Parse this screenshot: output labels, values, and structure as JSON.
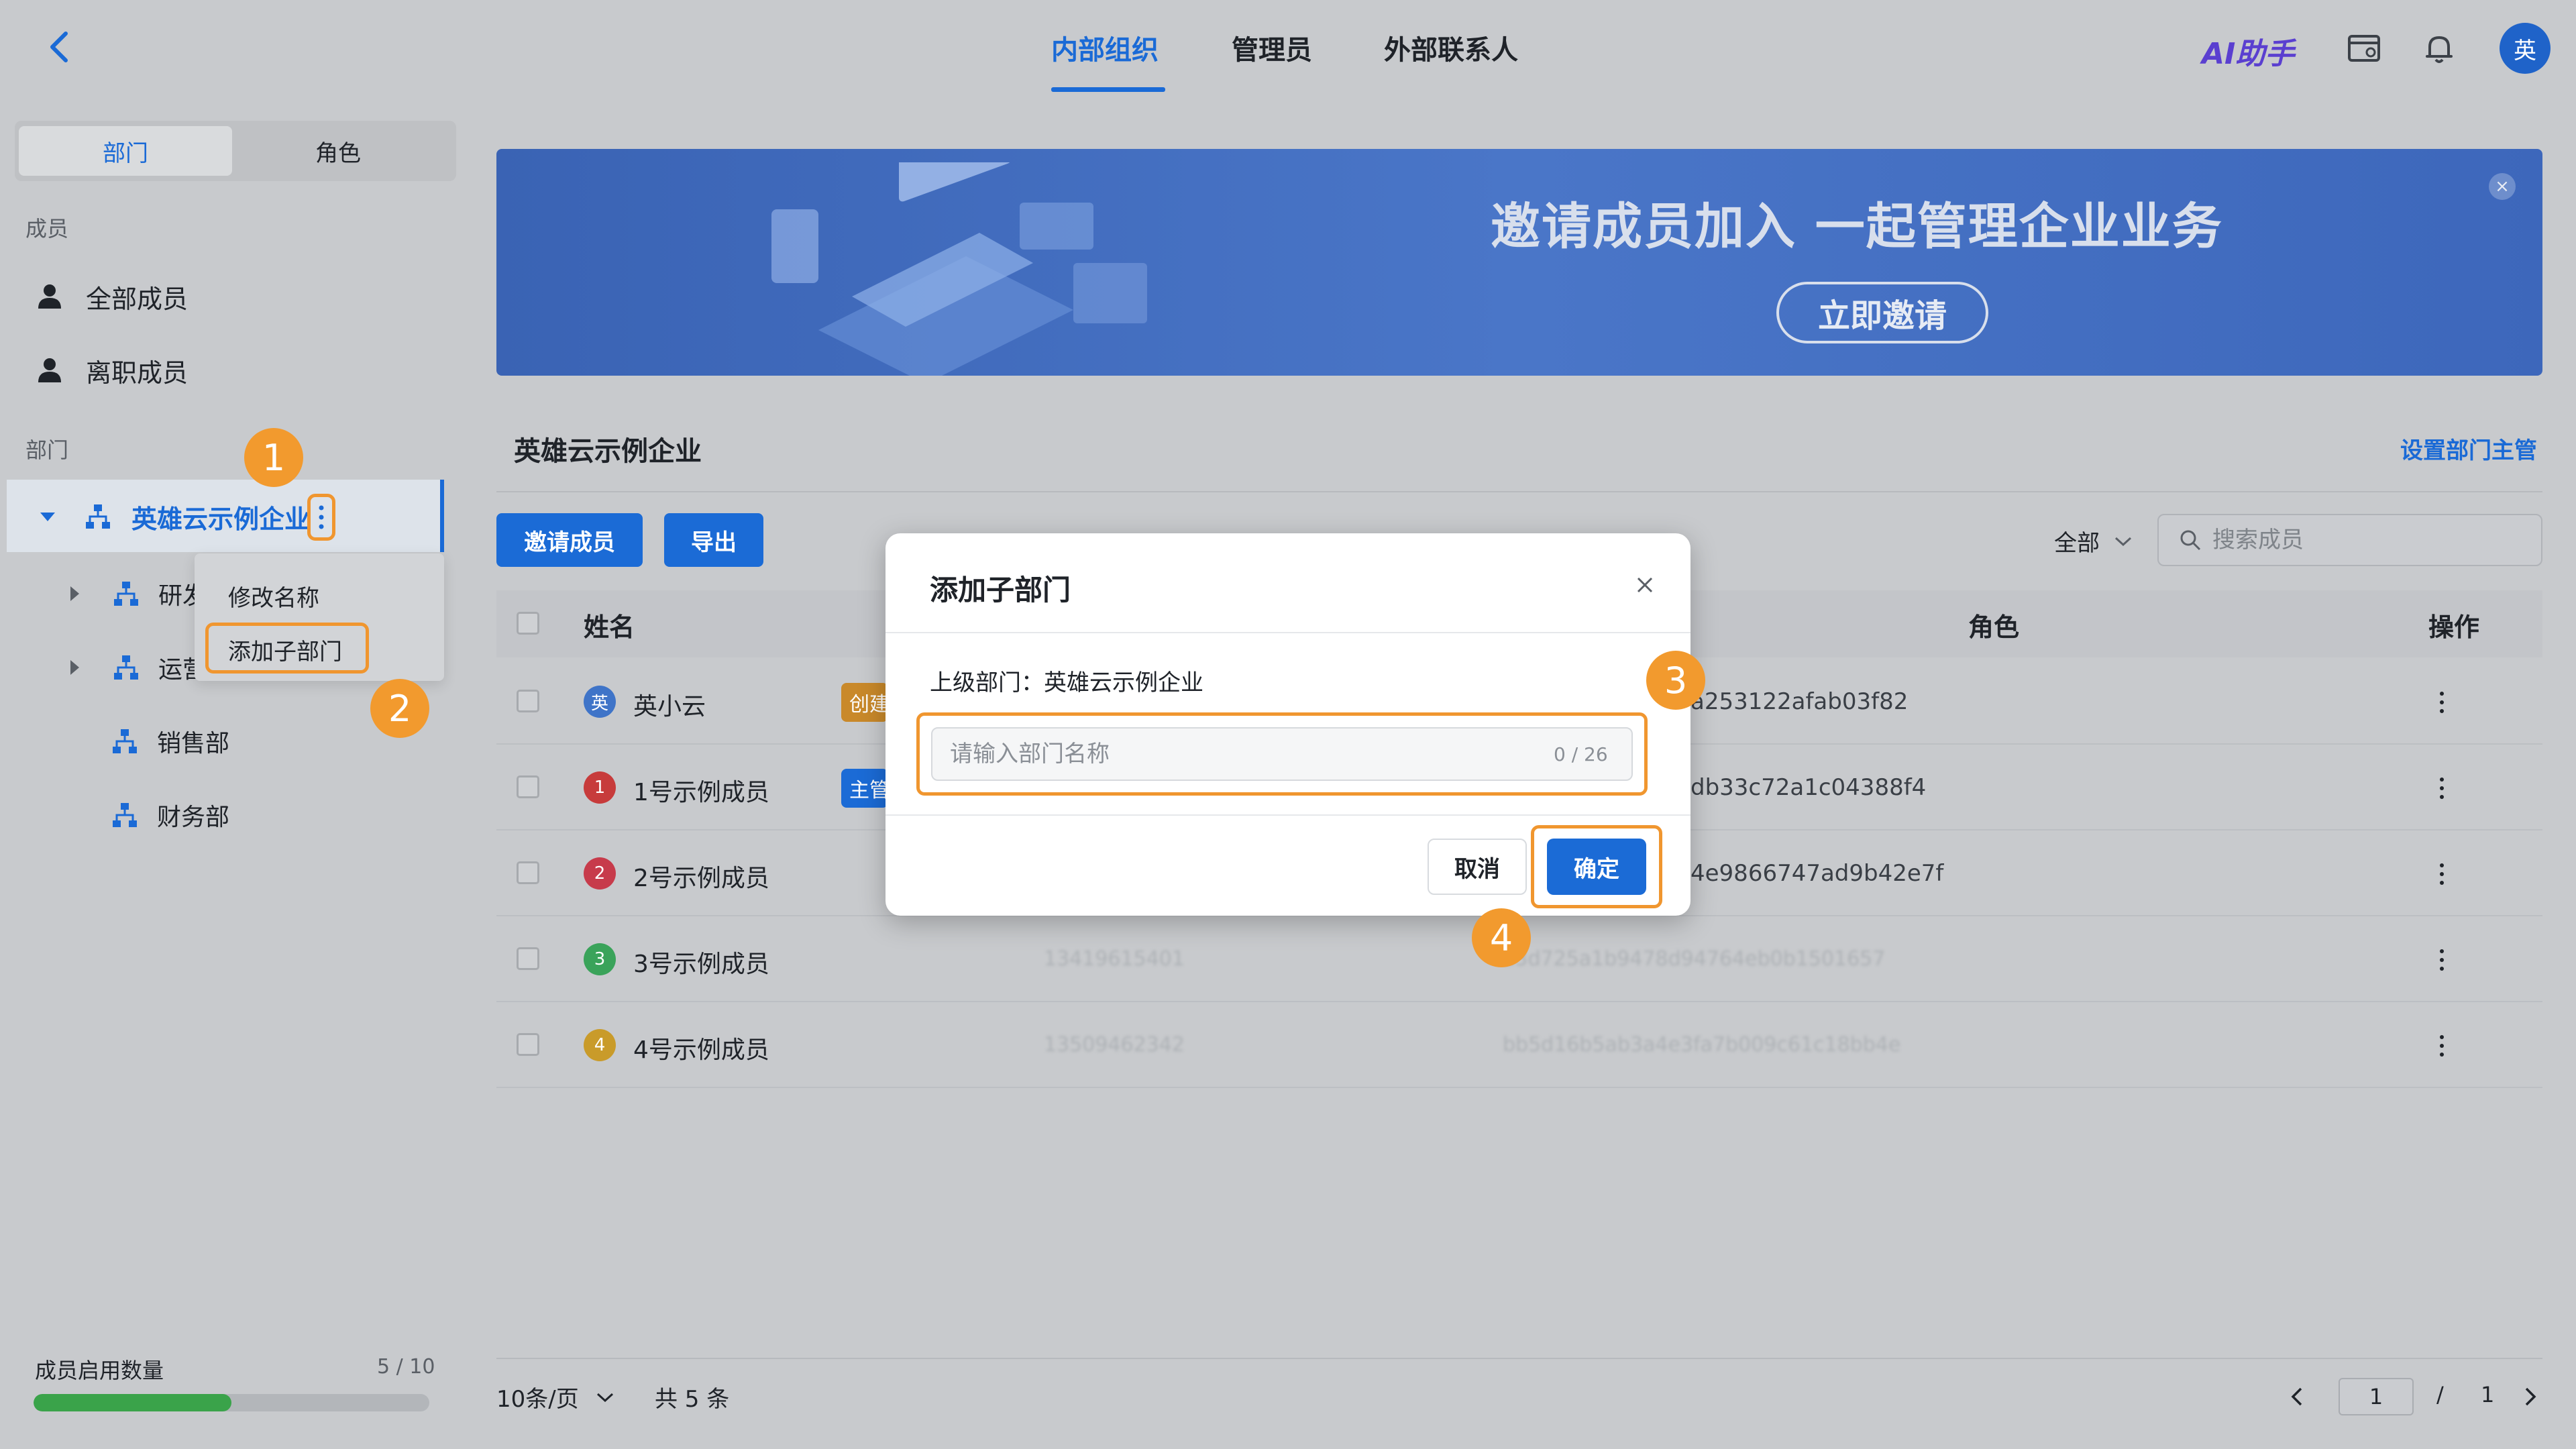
{
  "header": {
    "tabs": [
      {
        "label": "内部组织",
        "active": true
      },
      {
        "label": "管理员",
        "active": false
      },
      {
        "label": "外部联系人",
        "active": false
      }
    ],
    "ai_label": "AI助手",
    "avatar_text": "英"
  },
  "sidebar": {
    "segments": [
      "部门",
      "角色"
    ],
    "members_section": "成员",
    "member_items": [
      "全部成员",
      "离职成员"
    ],
    "dept_section": "部门",
    "root_dept": "英雄云示例企业",
    "children": [
      "研发部",
      "运营部",
      "销售部",
      "财务部"
    ],
    "context_menu": [
      "修改名称",
      "添加子部门"
    ],
    "usage_label": "成员启用数量",
    "usage_count": "5 / 10",
    "usage_fraction": 0.5
  },
  "banner": {
    "title": "邀请成员加入 一起管理企业业务",
    "button": "立即邀请",
    "close": "×"
  },
  "main": {
    "org_title": "英雄云示例企业",
    "set_lead": "设置部门主管",
    "invite_btn": "邀请成员",
    "export_btn": "导出",
    "filter": "全部",
    "search_placeholder": "搜索成员",
    "columns": {
      "name": "姓名",
      "role": "角色",
      "action": "操作"
    },
    "rows": [
      {
        "avatar": "英",
        "name": "英小云",
        "tag": "创建",
        "id_tail": "a253122afab03f82",
        "phone": "",
        "color": "#3f74c8",
        "tag_color": "#c9892a"
      },
      {
        "avatar": "1",
        "name": "1号示例成员",
        "tag": "主管",
        "id_tail": "db33c72a1c04388f4",
        "phone": "",
        "color": "#c73b3b",
        "tag_color": "#1b6bd6"
      },
      {
        "avatar": "2",
        "name": "2号示例成员",
        "tag": "",
        "id_tail": "4e9866747ad9b42e7f",
        "phone": "",
        "color": "#c73b4b",
        "tag_color": ""
      },
      {
        "avatar": "3",
        "name": "3号示例成员",
        "tag": "",
        "id_tail": "",
        "phone": "13419615401",
        "blur_id": "a3d725a1b9478d94764eb0b1501657",
        "color": "#3aa35a",
        "tag_color": ""
      },
      {
        "avatar": "4",
        "name": "4号示例成员",
        "tag": "",
        "id_tail": "",
        "phone": "13509462342",
        "blur_id": "bb5d16b5ab3a4e3fa7b009c61c18bb4e",
        "color": "#c99b2a",
        "tag_color": ""
      }
    ]
  },
  "footer": {
    "page_size": "10条/页",
    "total": "共 5 条",
    "current_page": "1",
    "slash": "/",
    "total_pages": "1"
  },
  "modal": {
    "title": "添加子部门",
    "parent_label": "上级部门：英雄云示例企业",
    "input_placeholder": "请输入部门名称",
    "input_value": "",
    "char_count": "0 / 26",
    "cancel": "取消",
    "confirm": "确定"
  },
  "annotations": [
    "1",
    "2",
    "3",
    "4"
  ],
  "colors": {
    "accent": "#1a6ad6",
    "highlight_orange": "#f0962f",
    "usage_green": "#3aa34a"
  }
}
